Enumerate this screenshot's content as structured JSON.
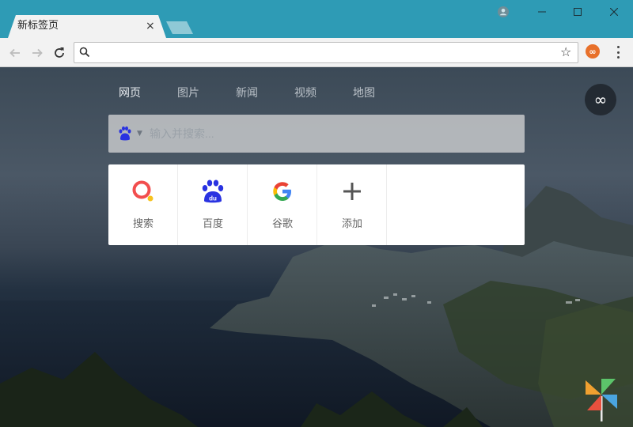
{
  "window": {
    "tab_title": "新标签页",
    "tab_close": "×"
  },
  "toolbar": {
    "address_value": "",
    "address_placeholder": ""
  },
  "newtab": {
    "engines": [
      "网页",
      "图片",
      "新闻",
      "视频",
      "地图"
    ],
    "active_engine": "网页",
    "search_placeholder": "输入并搜索...",
    "infinity_symbol": "∞",
    "tiles": [
      {
        "label": "搜索",
        "icon": "search-q-icon"
      },
      {
        "label": "百度",
        "icon": "baidu-paw-icon"
      },
      {
        "label": "谷歌",
        "icon": "google-g-icon"
      },
      {
        "label": "添加",
        "icon": "plus-icon"
      }
    ]
  },
  "colors": {
    "titlebar": "#2e9bb5",
    "toolbar": "#f2f2f2",
    "baidu_blue": "#2932e1",
    "search_q_red": "#f24e4e",
    "search_q_yellow": "#f7c21f",
    "extension_orange": "#e8702a"
  }
}
